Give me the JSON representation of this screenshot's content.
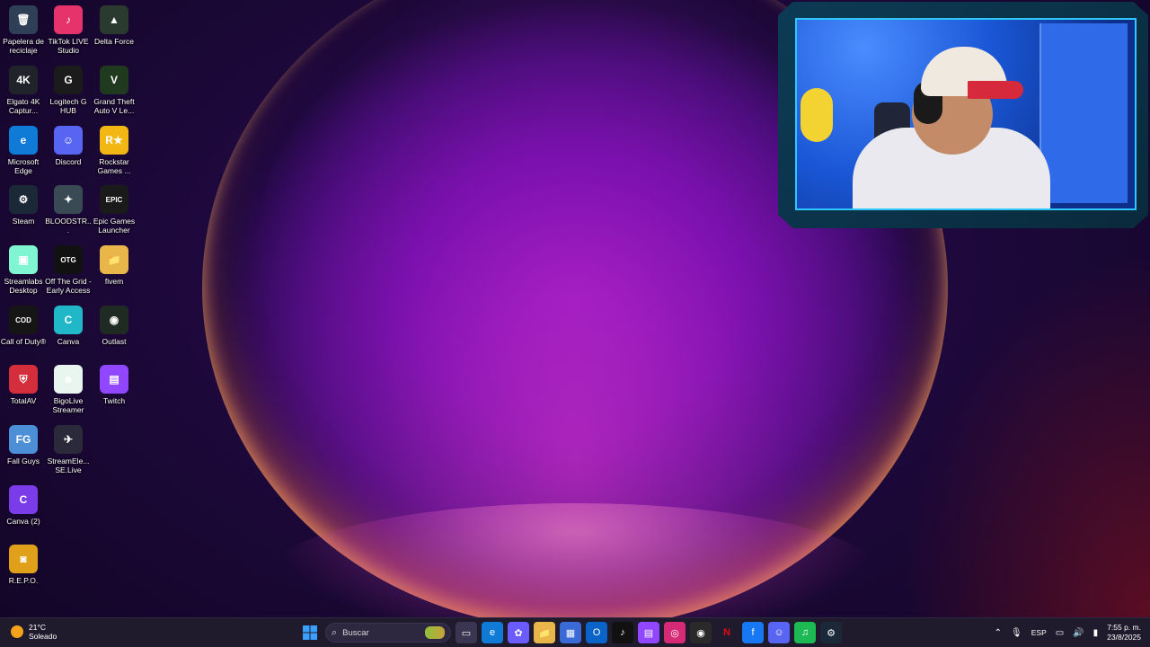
{
  "desktop_icons": [
    {
      "label": "Papelera de reciclaje",
      "icon": "recycle-bin-icon",
      "glyph": "🗑",
      "color": "#2f3f55",
      "col": 0,
      "row": 0
    },
    {
      "label": "TikTok LIVE Studio",
      "icon": "tiktok-live-icon",
      "glyph": "♪",
      "color": "#e6336b",
      "col": 1,
      "row": 0
    },
    {
      "label": "Delta Force",
      "icon": "delta-force-icon",
      "glyph": "▲",
      "color": "#2b3a2f",
      "col": 2,
      "row": 0
    },
    {
      "label": "Elgato 4K Captur...",
      "icon": "elgato-icon",
      "glyph": "4K",
      "color": "#20232a",
      "col": 0,
      "row": 1
    },
    {
      "label": "Logitech G HUB",
      "icon": "logitech-icon",
      "glyph": "G",
      "color": "#1b1b1b",
      "col": 1,
      "row": 1
    },
    {
      "label": "Grand Theft Auto V Le...",
      "icon": "gta-icon",
      "glyph": "V",
      "color": "#1f3a1f",
      "col": 2,
      "row": 1
    },
    {
      "label": "Microsoft Edge",
      "icon": "edge-icon",
      "glyph": "e",
      "color": "#0f7bd6",
      "col": 0,
      "row": 2
    },
    {
      "label": "Discord",
      "icon": "discord-icon",
      "glyph": "☺",
      "color": "#5865f2",
      "col": 1,
      "row": 2
    },
    {
      "label": "Rockstar Games ...",
      "icon": "rockstar-icon",
      "glyph": "R★",
      "color": "#f2b713",
      "col": 2,
      "row": 2
    },
    {
      "label": "Steam",
      "icon": "steam-icon",
      "glyph": "⚙",
      "color": "#1b2838",
      "col": 0,
      "row": 3
    },
    {
      "label": "BLOODSTR...",
      "icon": "bloodstrike-icon",
      "glyph": "✦",
      "color": "#3a4a55",
      "col": 1,
      "row": 3
    },
    {
      "label": "Epic Games Launcher",
      "icon": "epic-games-icon",
      "glyph": "EPIC",
      "color": "#1a1a1a",
      "col": 2,
      "row": 3
    },
    {
      "label": "Streamlabs Desktop",
      "icon": "streamlabs-icon",
      "glyph": "▣",
      "color": "#80f5d2",
      "col": 0,
      "row": 4
    },
    {
      "label": "Off The Grid - Early Access",
      "icon": "off-the-grid-icon",
      "glyph": "OTG",
      "color": "#111",
      "col": 1,
      "row": 4
    },
    {
      "label": "fivem",
      "icon": "folder-icon",
      "glyph": "📁",
      "color": "#e9b64a",
      "col": 2,
      "row": 4
    },
    {
      "label": "Call of Duty®",
      "icon": "call-of-duty-icon",
      "glyph": "COD",
      "color": "#151515",
      "col": 0,
      "row": 5
    },
    {
      "label": "Canva",
      "icon": "canva-icon",
      "glyph": "C",
      "color": "#20b7c8",
      "col": 1,
      "row": 5
    },
    {
      "label": "Outlast",
      "icon": "outlast-icon",
      "glyph": "◉",
      "color": "#1e2a22",
      "col": 2,
      "row": 5
    },
    {
      "label": "TotalAV",
      "icon": "totalav-icon",
      "glyph": "⛨",
      "color": "#d42d3c",
      "col": 0,
      "row": 6
    },
    {
      "label": "BigoLive Streamer",
      "icon": "bigolive-icon",
      "glyph": "☻",
      "color": "#e9f5ef",
      "col": 1,
      "row": 6
    },
    {
      "label": "Twitch",
      "icon": "twitch-icon",
      "glyph": "▤",
      "color": "#9146ff",
      "col": 2,
      "row": 6
    },
    {
      "label": "Fall Guys",
      "icon": "fall-guys-icon",
      "glyph": "FG",
      "color": "#4d8fd6",
      "col": 0,
      "row": 7
    },
    {
      "label": "StreamEle... SE.Live",
      "icon": "streamelements-icon",
      "glyph": "✈",
      "color": "#2a2a3a",
      "col": 1,
      "row": 7
    },
    {
      "label": "Canva (2)",
      "icon": "canva-icon",
      "glyph": "C",
      "color": "#7a3ce8",
      "col": 0,
      "row": 8
    },
    {
      "label": "R.E.P.O.",
      "icon": "repo-icon",
      "glyph": "◙",
      "color": "#e0a01a",
      "col": 0,
      "row": 9
    }
  ],
  "taskbar": {
    "weather_temp": "21°C",
    "weather_desc": "Soleado",
    "search_placeholder": "Buscar",
    "language": "ESP",
    "time": "7:55 p. m.",
    "date": "23/8/2025",
    "pinned": [
      {
        "icon": "task-view-icon",
        "glyph": "▭",
        "color": "#3a3550"
      },
      {
        "icon": "edge-icon",
        "glyph": "e",
        "color": "#0f7bd6"
      },
      {
        "icon": "copilot-icon",
        "glyph": "✿",
        "color": "#6a5cff"
      },
      {
        "icon": "file-explorer-icon",
        "glyph": "📁",
        "color": "#e9b64a"
      },
      {
        "icon": "microsoft-store-icon",
        "glyph": "▦",
        "color": "#3a6ad6"
      },
      {
        "icon": "outlook-icon",
        "glyph": "O",
        "color": "#0a64c8"
      },
      {
        "icon": "tiktok-icon",
        "glyph": "♪",
        "color": "#111"
      },
      {
        "icon": "twitch-icon",
        "glyph": "▤",
        "color": "#9146ff"
      },
      {
        "icon": "instagram-icon",
        "glyph": "◎",
        "color": "#d62976"
      },
      {
        "icon": "obs-icon",
        "glyph": "◉",
        "color": "#2a2a2a"
      },
      {
        "icon": "netflix-icon",
        "glyph": "N",
        "color": "#1f1a2c"
      },
      {
        "icon": "facebook-icon",
        "glyph": "f",
        "color": "#1877f2"
      },
      {
        "icon": "discord-icon",
        "glyph": "☺",
        "color": "#5865f2"
      },
      {
        "icon": "spotify-icon",
        "glyph": "♫",
        "color": "#1db954"
      },
      {
        "icon": "steam-icon",
        "glyph": "⚙",
        "color": "#1b2838"
      }
    ]
  }
}
